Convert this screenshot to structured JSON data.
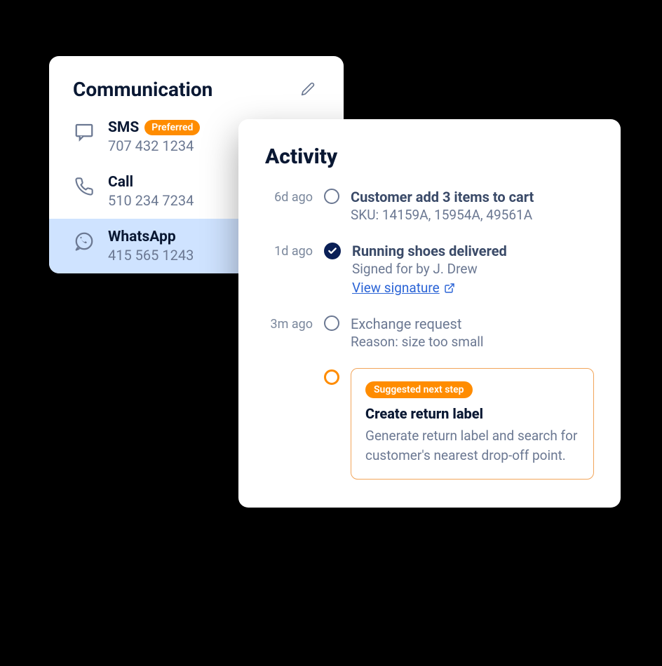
{
  "communication": {
    "title": "Communication",
    "items": [
      {
        "label": "SMS",
        "value": "707 432 1234",
        "preferred_badge": "Preferred"
      },
      {
        "label": "Call",
        "value": "510 234 7234"
      },
      {
        "label": "WhatsApp",
        "value": "415 565 1243"
      }
    ]
  },
  "activity": {
    "title": "Activity",
    "events": [
      {
        "time": "6d ago",
        "line1": "Customer add 3 items to cart",
        "line2": "SKU: 14159A, 15954A, 49561A"
      },
      {
        "time": "1d ago",
        "line1": "Running shoes delivered",
        "line2": "Signed for by J. Drew",
        "link_text": "View signature"
      },
      {
        "time": "3m ago",
        "line1": "Exchange request",
        "line2": "Reason: size too small"
      }
    ],
    "suggestion": {
      "badge": "Suggested next step",
      "title": "Create return label",
      "desc": "Generate return label and search for customer's nearest drop-off point."
    }
  }
}
